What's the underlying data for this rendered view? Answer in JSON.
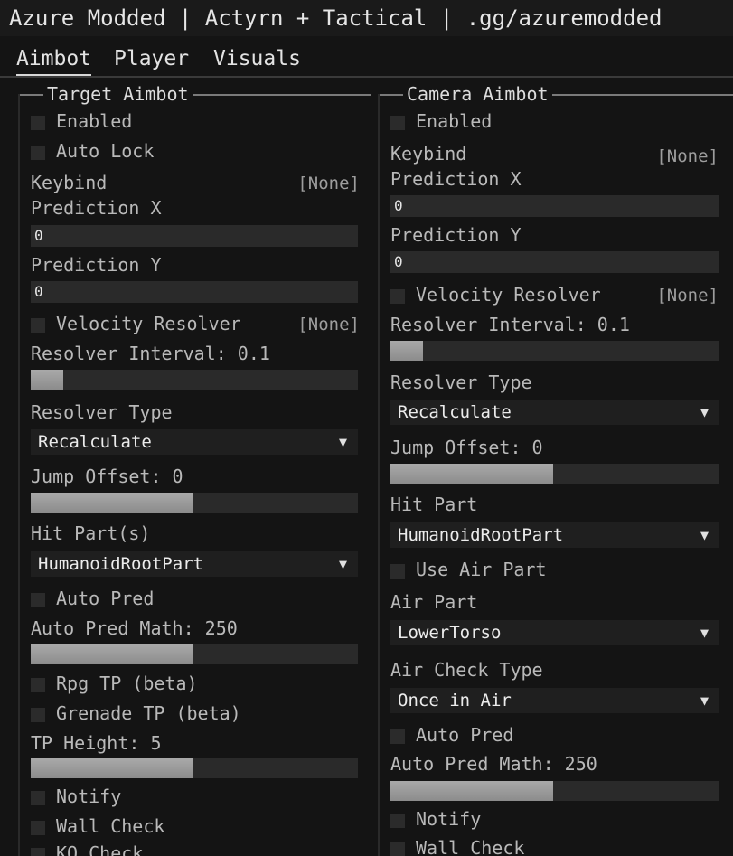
{
  "window": {
    "title": "Azure Modded | Actyrn + Tactical | .gg/azuremodded"
  },
  "tabs": [
    {
      "label": "Aimbot"
    },
    {
      "label": "Player"
    },
    {
      "label": "Visuals"
    }
  ],
  "left": {
    "title": "Target Aimbot",
    "enabled": "Enabled",
    "auto_lock": "Auto Lock",
    "keybind_label": "Keybind",
    "keybind_value": "[None]",
    "pred_x_label": "Prediction X",
    "pred_x_value": "0",
    "pred_y_label": "Prediction Y",
    "pred_y_value": "0",
    "velocity_label": "Velocity Resolver",
    "velocity_key": "[None]",
    "resolver_interval_label": "Resolver Interval: 0.1",
    "resolver_interval_value": 0.1,
    "resolver_type_label": "Resolver Type",
    "resolver_type_value": "Recalculate",
    "jump_offset_label": "Jump Offset: 0",
    "jump_offset_value": 0,
    "hit_parts_label": "Hit Part(s)",
    "hit_parts_value": "HumanoidRootPart",
    "auto_pred": "Auto Pred",
    "auto_pred_math_label": "Auto Pred Math: 250",
    "auto_pred_math_value": 250,
    "rpg_tp": "Rpg TP (beta)",
    "grenade_tp": "Grenade TP (beta)",
    "tp_height_label": "TP Height: 5",
    "tp_height_value": 5,
    "notify": "Notify",
    "wall_check": "Wall Check",
    "ko_check": "KO Check"
  },
  "right": {
    "title": "Camera Aimbot",
    "enabled": "Enabled",
    "keybind_label": "Keybind",
    "keybind_value": "[None]",
    "pred_x_label": "Prediction X",
    "pred_x_value": "0",
    "pred_y_label": "Prediction Y",
    "pred_y_value": "0",
    "velocity_label": "Velocity Resolver",
    "velocity_key": "[None]",
    "resolver_interval_label": "Resolver Interval: 0.1",
    "resolver_interval_value": 0.1,
    "resolver_type_label": "Resolver Type",
    "resolver_type_value": "Recalculate",
    "jump_offset_label": "Jump Offset: 0",
    "jump_offset_value": 0,
    "hit_part_label": "Hit Part",
    "hit_part_value": "HumanoidRootPart",
    "use_air_part": "Use Air Part",
    "air_part_label": "Air Part",
    "air_part_value": "LowerTorso",
    "air_check_label": "Air Check Type",
    "air_check_value": "Once in Air",
    "auto_pred": "Auto Pred",
    "auto_pred_math_label": "Auto Pred Math: 250",
    "auto_pred_math_value": 250,
    "notify": "Notify",
    "wall_check": "Wall Check"
  }
}
